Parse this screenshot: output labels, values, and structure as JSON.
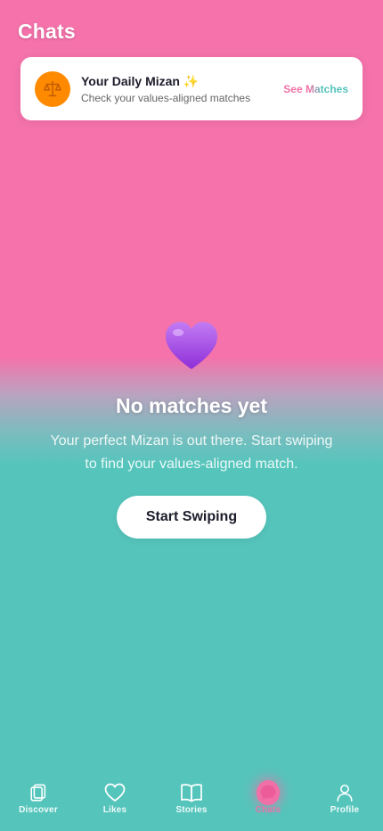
{
  "header": {
    "title": "Chats"
  },
  "daily_card": {
    "title": "Your Daily Mizan",
    "title_emoji": "✨",
    "subtitle": "Check your values-aligned matches",
    "action_label": "See Matches",
    "avatar_icon": "scales-icon"
  },
  "empty_state": {
    "icon": "purple-heart-icon",
    "title": "No matches yet",
    "description": "Your perfect Mizan is out there. Start swiping to find your values-aligned match.",
    "button_label": "Start Swiping"
  },
  "tabbar": {
    "active": "Chats",
    "items": [
      {
        "label": "Discover",
        "icon": "cards-icon"
      },
      {
        "label": "Likes",
        "icon": "heart-icon"
      },
      {
        "label": "Stories",
        "icon": "book-icon"
      },
      {
        "label": "Chats",
        "icon": "chat-bubble-icon"
      },
      {
        "label": "Profile",
        "icon": "person-icon"
      }
    ]
  },
  "colors": {
    "pink": "#f572ab",
    "teal": "#55c5bc",
    "accent_orange": "#ff8a00"
  }
}
